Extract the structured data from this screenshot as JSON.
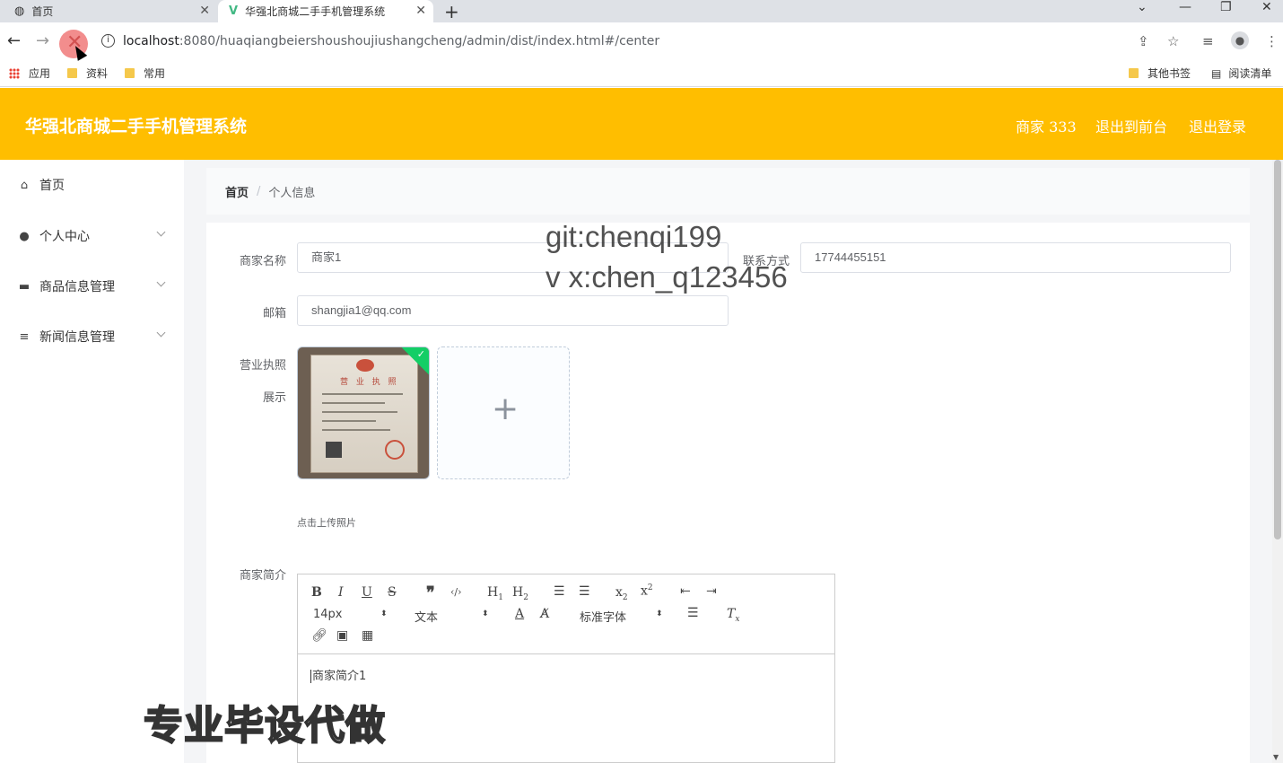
{
  "browser": {
    "tabs": [
      {
        "label": "首页",
        "icon": "globe-icon"
      },
      {
        "label": "华强北商城二手手机管理系统",
        "icon": "vue-icon"
      }
    ],
    "url_host": "localhost",
    "url_rest": ":8080/huaqiangbeiershoushoujiushangcheng/admin/dist/index.html#/center",
    "bookmarks": {
      "apps": "应用",
      "folder1": "资料",
      "folder2": "常用",
      "other": "其他书签",
      "reading": "阅读清单"
    }
  },
  "header": {
    "title": "华强北商城二手手机管理系统",
    "user": "商家 333",
    "exit_front": "退出到前台",
    "logout": "退出登录",
    "color": "#ffbe00"
  },
  "sidebar": {
    "items": [
      {
        "label": "首页",
        "icon": "home-icon"
      },
      {
        "label": "个人中心",
        "icon": "user-icon"
      },
      {
        "label": "商品信息管理",
        "icon": "chat-icon"
      },
      {
        "label": "新闻信息管理",
        "icon": "menu-icon"
      }
    ]
  },
  "breadcrumb": {
    "home": "首页",
    "separator": "/",
    "current": "个人信息"
  },
  "form": {
    "name_label": "商家名称",
    "name_value": "商家1",
    "contact_label": "联系方式",
    "contact_value": "17744455151",
    "email_label": "邮箱",
    "email_value": "shangjia1@qq.com",
    "license_label_1": "营业执照",
    "license_label_2": "展示",
    "license_image_text": "营 业 执 照",
    "upload_tip": "点击上传照片",
    "intro_label": "商家简介",
    "intro_value": "商家简介1"
  },
  "editor": {
    "font_size": "14px",
    "header_select": "文本",
    "font_family": "标准字体"
  },
  "watermarks": {
    "line1": "git:chenqi199",
    "line2": "v x:chen_q123456",
    "line3": "专业毕设代做"
  }
}
